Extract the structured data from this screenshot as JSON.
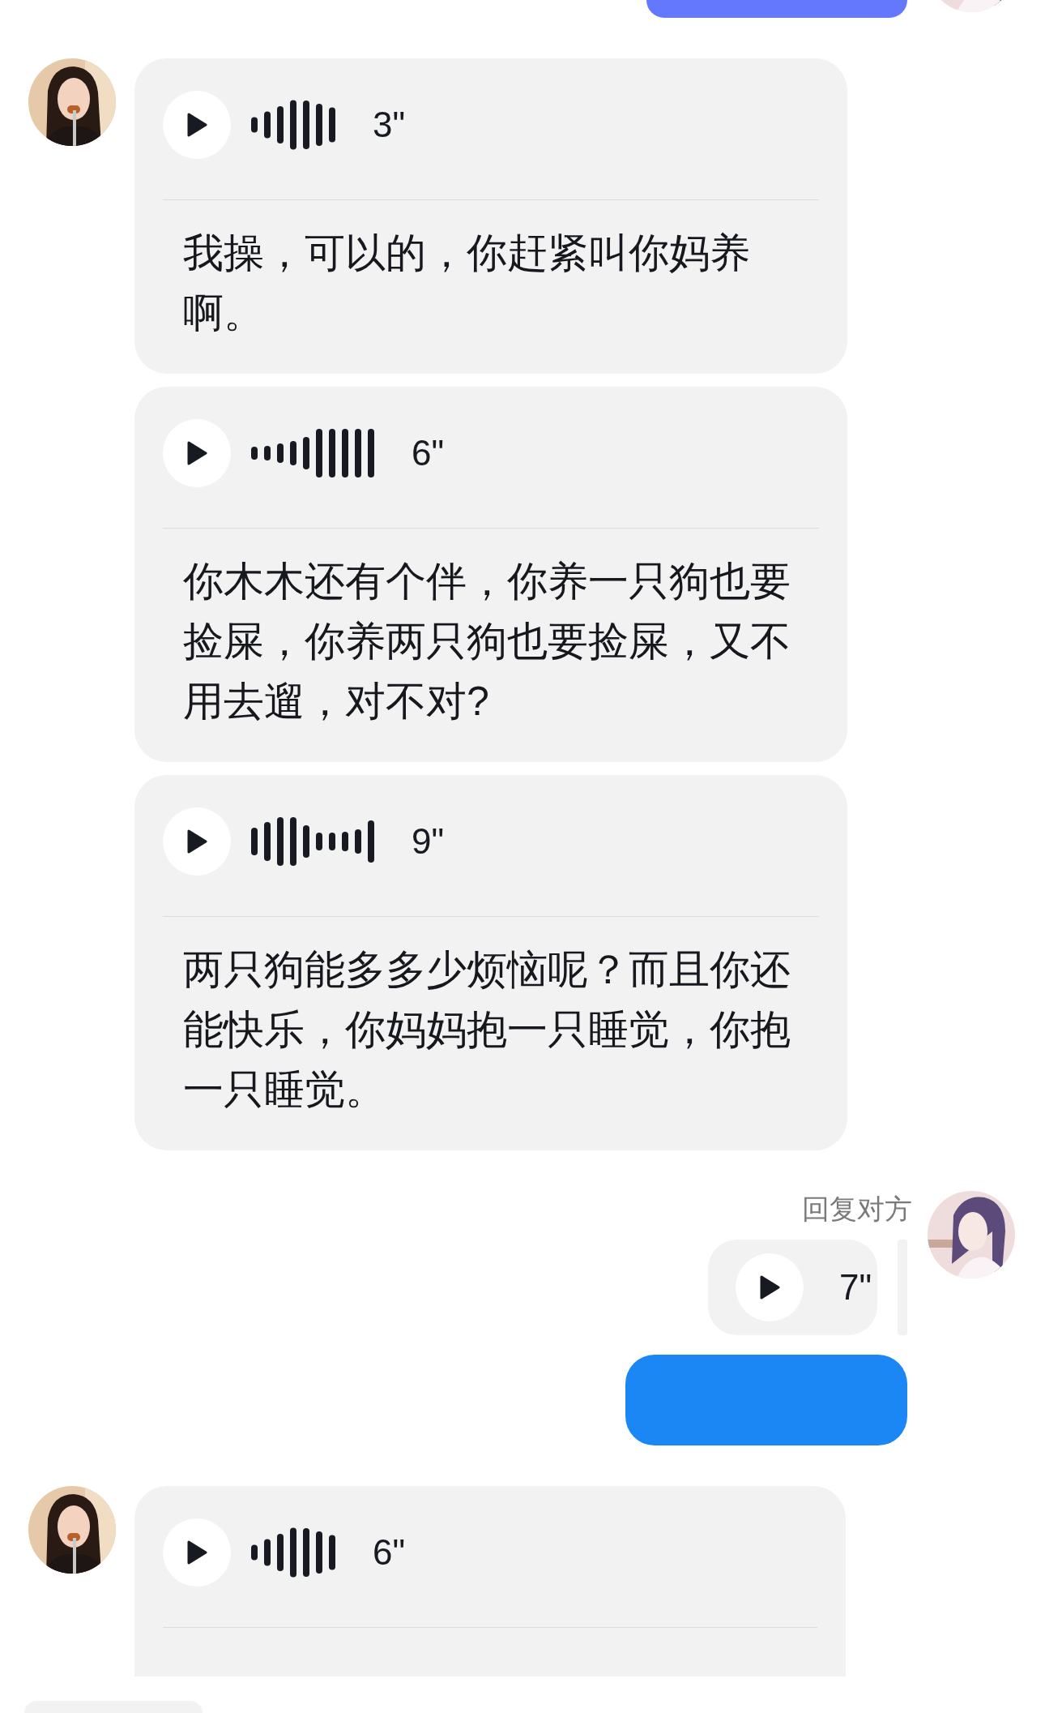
{
  "messages": [
    {
      "kind": "sent_edge",
      "color": "#6478fe"
    },
    {
      "kind": "received_voice",
      "duration": "3\"",
      "transcript": "我操，可以的，你赶紧叫你妈养啊。"
    },
    {
      "kind": "received_voice",
      "duration": "6\"",
      "transcript": "你木木还有个伴，你养一只狗也要捡屎，你养两只狗也要捡屎，又不用去遛，对不对?"
    },
    {
      "kind": "received_voice",
      "duration": "9\"",
      "transcript": "两只狗能多多少烦恼呢？而且你还能快乐，你妈妈抱一只睡觉，你抱一只睡觉。"
    },
    {
      "kind": "sent_voice",
      "label": "回复对方",
      "duration": "7\""
    },
    {
      "kind": "sent_bubble",
      "color": "#1b87f5"
    },
    {
      "kind": "received_voice",
      "duration": "6\""
    }
  ]
}
